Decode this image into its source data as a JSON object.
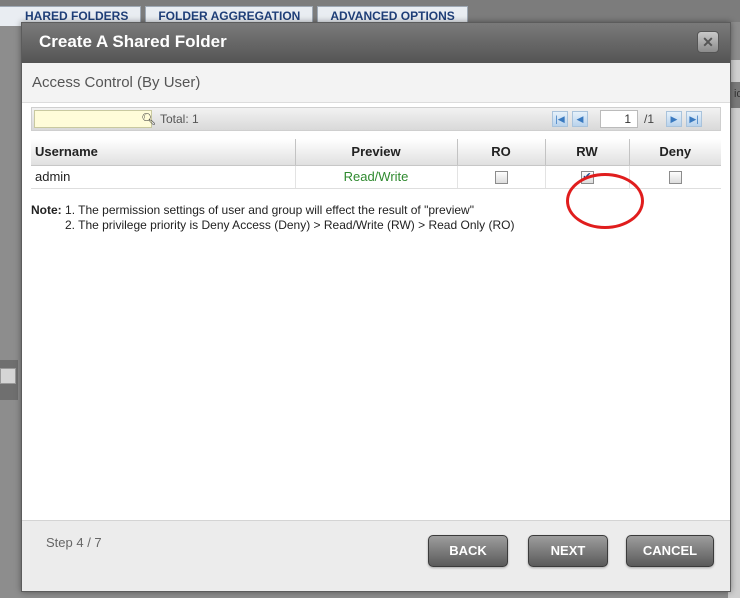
{
  "background": {
    "tabs": [
      "HARED FOLDERS",
      "FOLDER AGGREGATION",
      "ADVANCED OPTIONS"
    ],
    "right_header": "id"
  },
  "dialog": {
    "title": "Create A Shared Folder",
    "close_icon": "close-icon",
    "section_title": "Access Control (By User)",
    "toolbar": {
      "search_placeholder": "",
      "total_label": "Total: 1",
      "page_value": "1",
      "page_total": "/1"
    },
    "table": {
      "headers": [
        "Username",
        "Preview",
        "RO",
        "RW",
        "Deny"
      ],
      "rows": [
        {
          "username": "admin",
          "preview": "Read/Write",
          "ro": false,
          "rw": true,
          "deny": false
        }
      ]
    },
    "note": {
      "label": "Note:",
      "line1": "1. The permission settings of user and group will effect the result of \"preview\"",
      "line2": "2. The privilege priority is Deny Access (Deny) > Read/Write (RW) > Read Only (RO)"
    },
    "footer": {
      "step": "Step 4 / 7",
      "back_label": "BACK",
      "next_label": "NEXT",
      "cancel_label": "CANCEL"
    }
  },
  "colors": {
    "accent": "#1f4f97",
    "preview_green": "#2f8a2f",
    "highlight_red": "#e01d1d"
  }
}
